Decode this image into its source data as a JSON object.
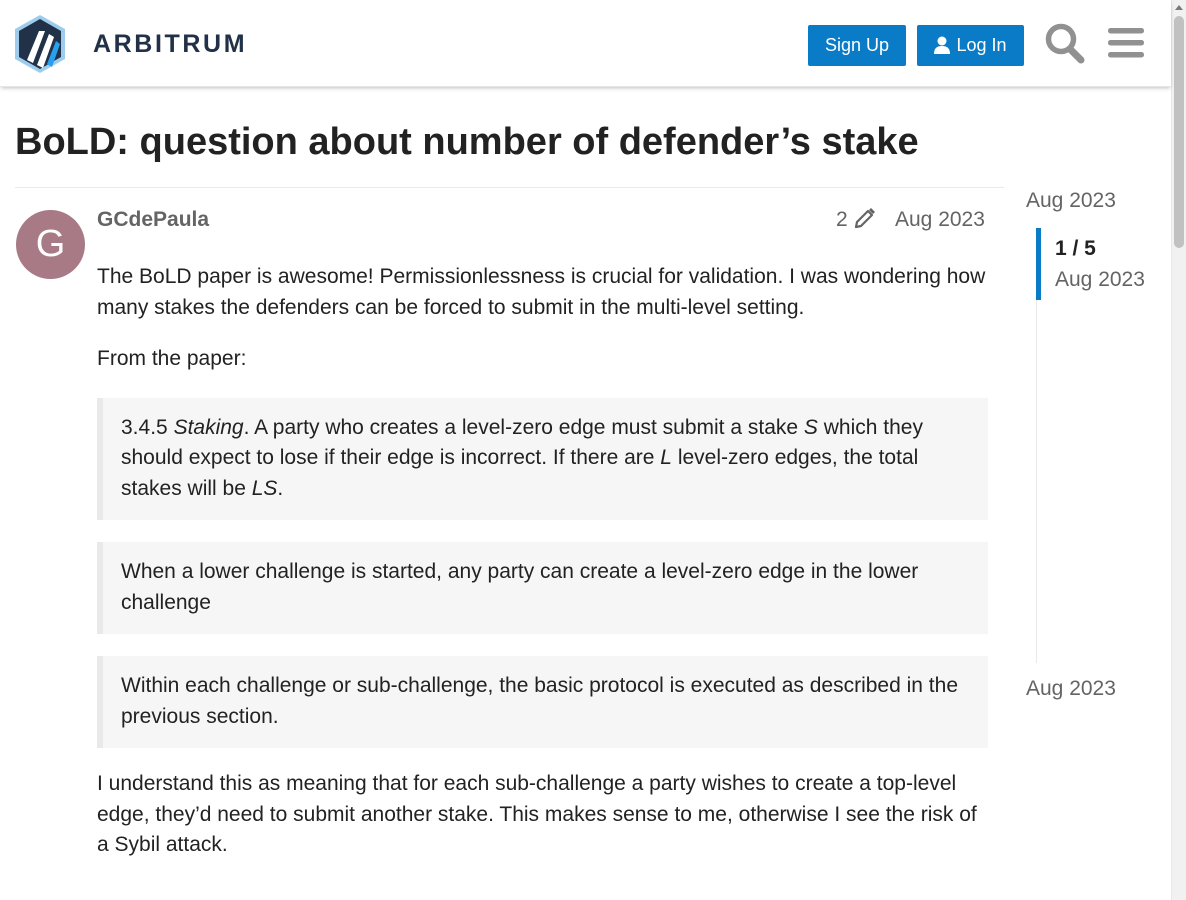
{
  "header": {
    "logo_text": "ARBITRUM",
    "signup_label": "Sign Up",
    "login_label": "Log In",
    "search_icon": "search-icon",
    "menu_icon": "hamburger-menu-icon",
    "brand_color": "#0a7cc7"
  },
  "topic": {
    "title": "BoLD: question about number of defender’s stake"
  },
  "post": {
    "avatar_letter": "G",
    "avatar_color": "#a87a86",
    "username": "GCdePaula",
    "edit_count": "2",
    "date": "Aug 2023",
    "paragraph_1": "The BoLD paper is awesome! Permissionlessness is crucial for validation. I was wondering how many stakes the defenders can be forced to submit in the multi-level setting.",
    "paragraph_2": "From the paper:",
    "quote_1": {
      "section": "3.4.5",
      "heading": "Staking",
      "text_a": ". A party who creates a level-zero edge must submit a stake ",
      "var_s": "S",
      "text_b": " which they should expect to lose if their edge is incorrect. If there are ",
      "var_l": "L",
      "text_c": " level-zero edges, the total stakes will be ",
      "var_ls": "LS",
      "text_d": "."
    },
    "quote_2": "When a lower challenge is started, any party can create a level-zero edge in the lower challenge",
    "quote_3": "Within each challenge or sub-challenge, the basic protocol is executed as described in the previous section.",
    "paragraph_3": "I understand this as meaning that for each sub-challenge a party wishes to create a top-level edge, they’d need to submit another stake. This makes sense to me, otherwise I see the risk of a Sybil attack."
  },
  "timeline": {
    "start_date": "Aug 2023",
    "position": "1 / 5",
    "position_date": "Aug 2023",
    "end_date": "Aug 2023"
  }
}
